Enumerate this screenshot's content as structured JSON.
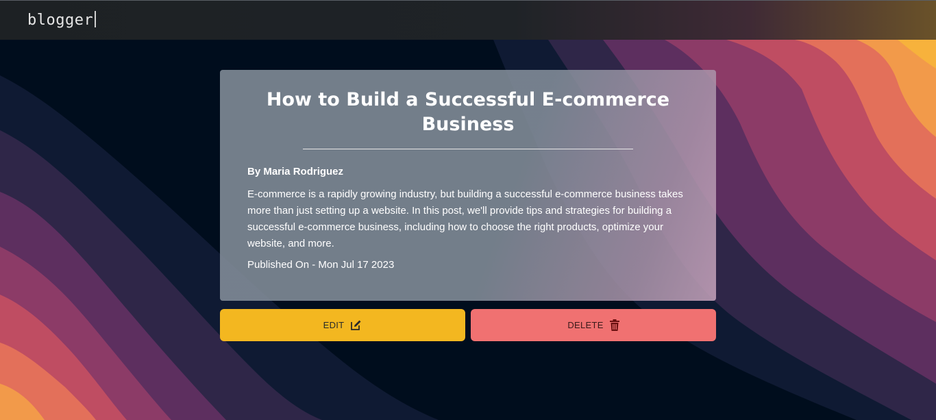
{
  "navbar": {
    "brand": "blogger"
  },
  "post": {
    "title": "How to Build a Successful E-commerce Business",
    "author": "By Maria Rodriguez",
    "body": "E-commerce is a rapidly growing industry, but building a successful e-commerce business takes more than just setting up a website. In this post, we'll provide tips and strategies for building a successful e-commerce business, including how to choose the right products, optimize your website, and more.",
    "published": "Published On - Mon Jul 17 2023"
  },
  "actions": {
    "edit_label": "EDIT",
    "edit_icon": "edit-icon",
    "delete_label": "DELETE",
    "delete_icon": "trash-icon"
  },
  "colors": {
    "edit_button": "#f3b720",
    "delete_button": "#f07171",
    "background_dark": "#000d1d"
  }
}
